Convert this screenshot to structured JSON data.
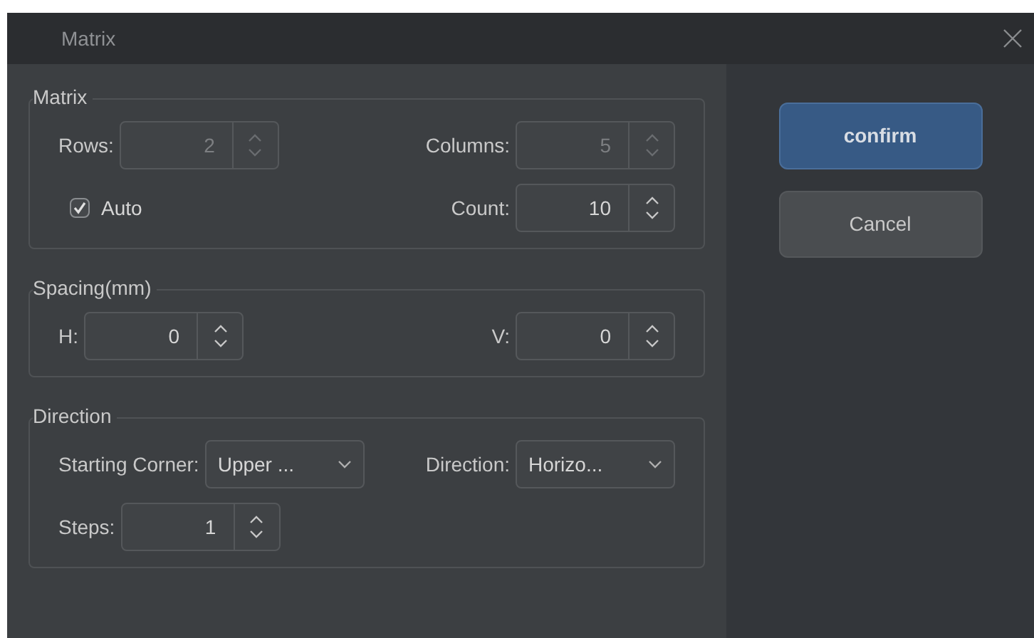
{
  "window": {
    "title": "Matrix"
  },
  "groups": [
    {
      "title": "Matrix",
      "rows": [
        [
          {
            "kind": "spin",
            "label": "Rows:",
            "value": "2",
            "disabled": true
          },
          {
            "kind": "spin",
            "label": "Columns:",
            "value": "5",
            "disabled": true
          }
        ],
        [
          {
            "kind": "check",
            "label": "Auto",
            "checked": true
          },
          {
            "kind": "spin",
            "label": "Count:",
            "value": "10",
            "disabled": false
          }
        ]
      ]
    },
    {
      "title": "Spacing(mm)",
      "rows": [
        [
          {
            "kind": "spin",
            "label": "H:",
            "value": "0",
            "disabled": false
          },
          {
            "kind": "spin",
            "label": "V:",
            "value": "0",
            "disabled": false
          }
        ]
      ]
    },
    {
      "title": "Direction",
      "rows": [
        [
          {
            "kind": "combo",
            "label": "Starting Corner:",
            "value": "Upper ..."
          },
          {
            "kind": "combo",
            "label": "Direction:",
            "value": "Horizo..."
          }
        ],
        [
          {
            "kind": "spin",
            "label": "Steps:",
            "value": "1",
            "disabled": false
          }
        ]
      ]
    }
  ],
  "buttons": [
    {
      "label": "confirm",
      "primary": true
    },
    {
      "label": "Cancel",
      "primary": false
    }
  ]
}
